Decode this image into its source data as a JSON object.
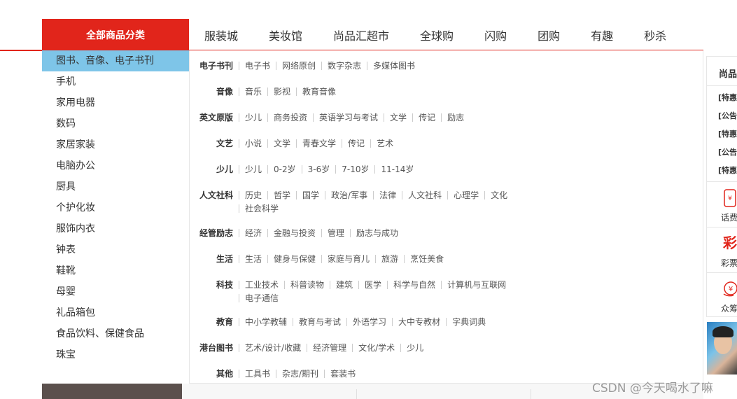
{
  "header": {
    "all_categories": "全部商品分类",
    "nav": [
      "服装城",
      "美妆馆",
      "尚品汇超市",
      "全球购",
      "闪购",
      "团购",
      "有趣",
      "秒杀"
    ]
  },
  "sidebar": {
    "active_color": "#7ec5e8",
    "categories": [
      "图书、音像、电子书刊",
      "手机",
      "家用电器",
      "数码",
      "家居家装",
      "电脑办公",
      "厨具",
      "个护化妆",
      "服饰内衣",
      "钟表",
      "鞋靴",
      "母婴",
      "礼品箱包",
      "食品饮料、保健食品",
      "珠宝"
    ]
  },
  "panel": {
    "rows": [
      {
        "title": "电子书刊",
        "links": [
          "电子书",
          "网络原创",
          "数字杂志",
          "多媒体图书"
        ]
      },
      {
        "title": "音像",
        "links": [
          "音乐",
          "影视",
          "教育音像"
        ]
      },
      {
        "title": "英文原版",
        "links": [
          "少儿",
          "商务投资",
          "英语学习与考试",
          "文学",
          "传记",
          "励志"
        ]
      },
      {
        "title": "文艺",
        "links": [
          "小说",
          "文学",
          "青春文学",
          "传记",
          "艺术"
        ]
      },
      {
        "title": "少儿",
        "links": [
          "少儿",
          "0-2岁",
          "3-6岁",
          "7-10岁",
          "11-14岁"
        ]
      },
      {
        "title": "人文社科",
        "links": [
          "历史",
          "哲学",
          "国学",
          "政治/军事",
          "法律",
          "人文社科",
          "心理学",
          "文化",
          "社会科学"
        ]
      },
      {
        "title": "经管励志",
        "links": [
          "经济",
          "金融与投资",
          "管理",
          "励志与成功"
        ]
      },
      {
        "title": "生活",
        "links": [
          "生活",
          "健身与保健",
          "家庭与育儿",
          "旅游",
          "烹饪美食"
        ]
      },
      {
        "title": "科技",
        "links": [
          "工业技术",
          "科普读物",
          "建筑",
          "医学",
          "科学与自然",
          "计算机与互联网",
          "电子通信"
        ]
      },
      {
        "title": "教育",
        "links": [
          "中小学教辅",
          "教育与考试",
          "外语学习",
          "大中专教材",
          "字典词典"
        ]
      },
      {
        "title": "港台图书",
        "links": [
          "艺术/设计/收藏",
          "经济管理",
          "文化/学术",
          "少儿"
        ]
      },
      {
        "title": "其他",
        "links": [
          "工具书",
          "杂志/期刊",
          "套装书"
        ]
      }
    ]
  },
  "right": {
    "title": "尚品",
    "notices": [
      "[特惠",
      "[公告",
      "[特惠",
      "[公告",
      "[特惠"
    ],
    "services": [
      {
        "label": "话费",
        "icon": "phone-recharge-icon"
      },
      {
        "label": "彩票",
        "glyph": "彩",
        "icon": "lottery-icon"
      },
      {
        "label": "众筹",
        "icon": "crowdfunding-icon"
      }
    ]
  },
  "watermark": "CSDN @今天喝水了嘛",
  "colors": {
    "brand_red": "#e1251b"
  }
}
